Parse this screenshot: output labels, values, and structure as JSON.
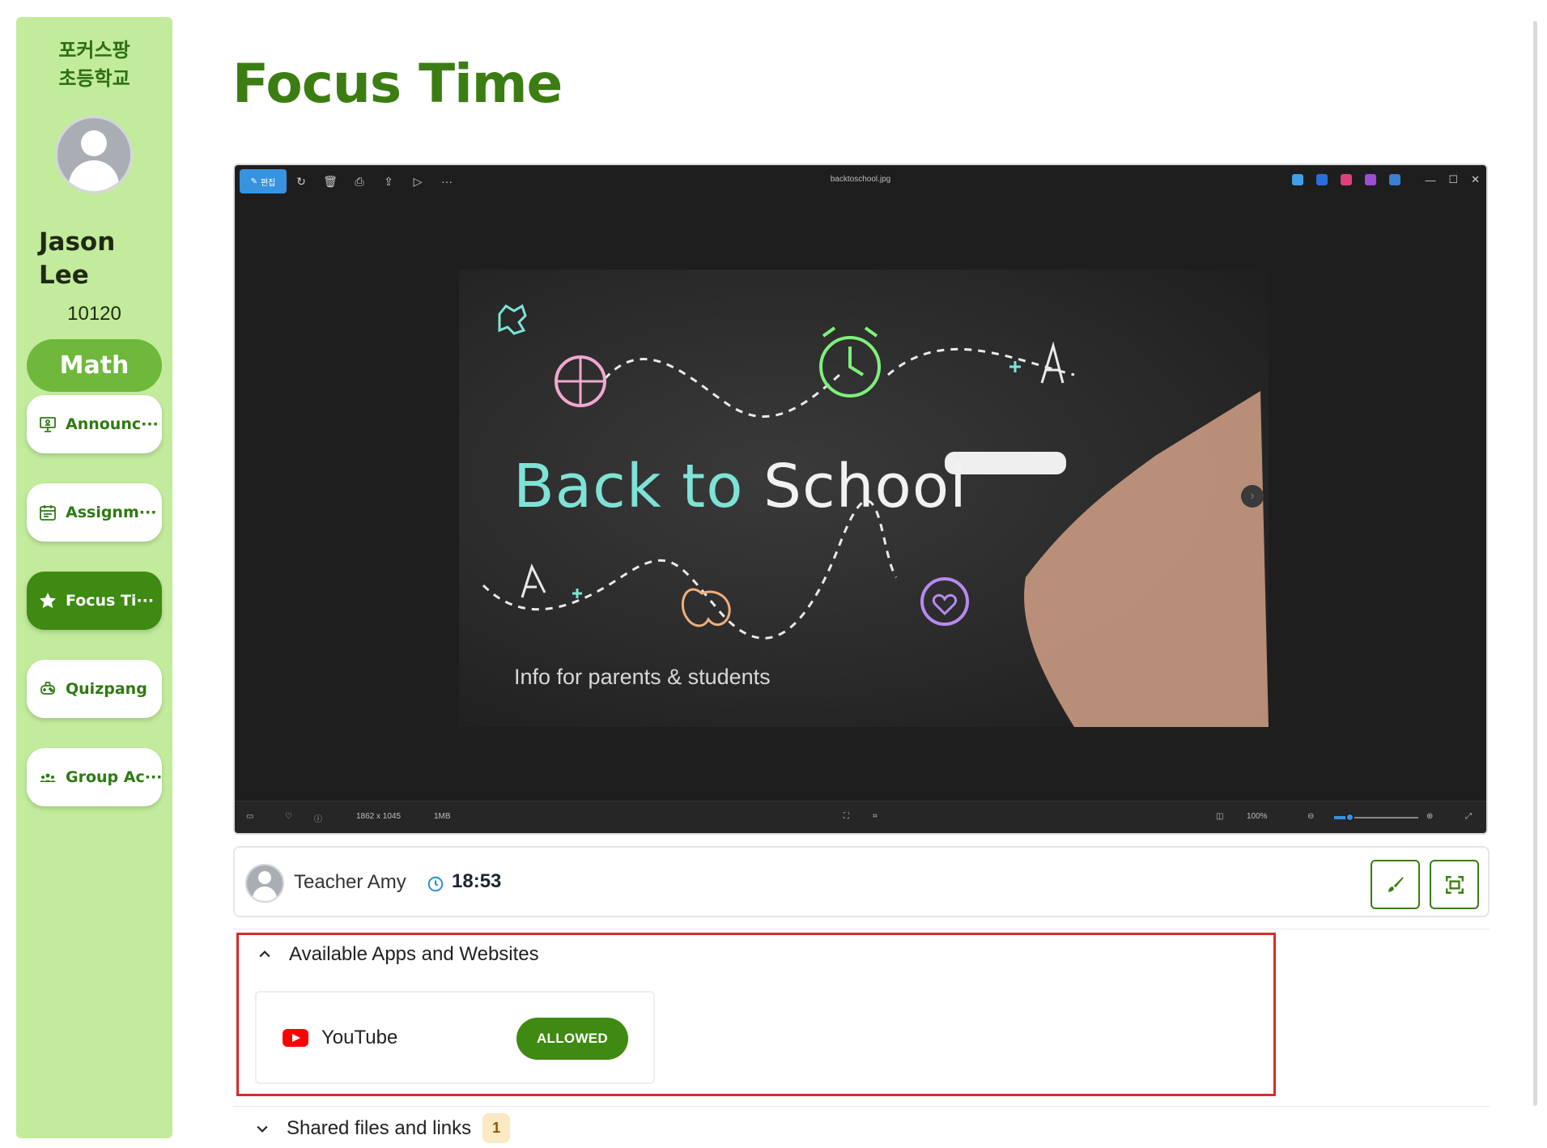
{
  "sidebar": {
    "school_name": "포커스팡\n초등학교",
    "student_name": "Jason\nLee",
    "student_id": "10120",
    "subject": "Math",
    "items": [
      {
        "label": "Announc···",
        "icon": "presentation-board-icon"
      },
      {
        "label": "Assignm···",
        "icon": "calendar-icon"
      },
      {
        "label": "Focus Ti···",
        "icon": "star-icon",
        "active": true
      },
      {
        "label": "Quizpang",
        "icon": "gamepad-icon"
      },
      {
        "label": "Group Ac···",
        "icon": "group-icon"
      }
    ]
  },
  "main": {
    "title": "Focus Time",
    "viewer": {
      "filename": "backtoschool.jpg",
      "edit_label": "편집",
      "image": {
        "title_word1": "Back to",
        "title_word2": "School",
        "subtitle": "Info for parents & students"
      },
      "status": {
        "dimensions": "1862 x 1045",
        "size": "1MB",
        "zoom": "100%"
      }
    },
    "teacher": {
      "name": "Teacher Amy",
      "timer": "18:53"
    },
    "available_apps": {
      "header": "Available Apps and Websites",
      "apps": [
        {
          "name": "YouTube",
          "status": "ALLOWED"
        }
      ]
    },
    "shared_files": {
      "header": "Shared files and links",
      "count": "1"
    }
  },
  "colors": {
    "sidebar_bg": "#c3eb9c",
    "brand_green": "#3b7d12",
    "active_green": "#3f8a12",
    "highlight_red": "#d62b2b"
  }
}
